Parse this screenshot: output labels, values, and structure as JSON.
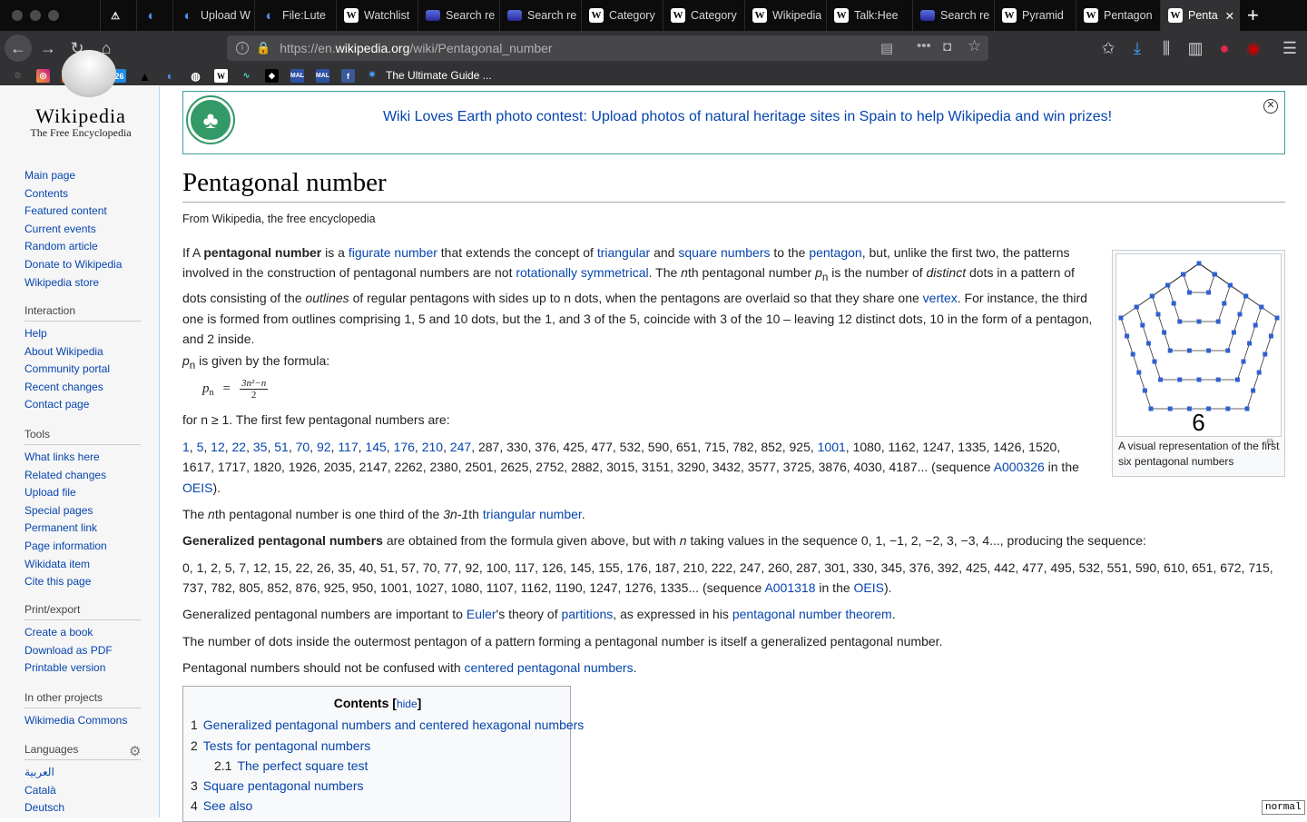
{
  "browser": {
    "tabs": [
      {
        "icon": "warning-icon",
        "label": ""
      },
      {
        "icon": "firefox-icon",
        "label": ""
      },
      {
        "icon": "firefox-icon",
        "label": "Upload W"
      },
      {
        "icon": "firefox-icon",
        "label": "File:Lute"
      },
      {
        "icon": "wikipedia-icon",
        "label": "Watchlist"
      },
      {
        "icon": "search-favicon",
        "label": "Search re"
      },
      {
        "icon": "search-favicon",
        "label": "Search re"
      },
      {
        "icon": "wikipedia-icon",
        "label": "Category"
      },
      {
        "icon": "wikipedia-icon",
        "label": "Category"
      },
      {
        "icon": "wikipedia-icon",
        "label": "Wikipedia"
      },
      {
        "icon": "wikipedia-icon",
        "label": "Talk:Hee"
      },
      {
        "icon": "search-favicon",
        "label": "Search re"
      },
      {
        "icon": "wikipedia-icon",
        "label": "Pyramid"
      },
      {
        "icon": "wikipedia-icon",
        "label": "Pentagon"
      },
      {
        "icon": "wikipedia-icon",
        "label": "Penta"
      }
    ],
    "url_prefix": "https://en.",
    "url_domain": "wikipedia.org",
    "url_path": "/wiki/Pentagonal_number",
    "bookmark_label": "The Ultimate Guide ...",
    "bookmark_icons": [
      "Y",
      "26",
      "MAL",
      "MAL",
      "f"
    ]
  },
  "sidebar": {
    "wordmark": "Wikipedia",
    "tagline": "The Free Encyclopedia",
    "nav": [
      "Main page",
      "Contents",
      "Featured content",
      "Current events",
      "Random article",
      "Donate to Wikipedia",
      "Wikipedia store"
    ],
    "interaction_heading": "Interaction",
    "interaction": [
      "Help",
      "About Wikipedia",
      "Community portal",
      "Recent changes",
      "Contact page"
    ],
    "tools_heading": "Tools",
    "tools": [
      "What links here",
      "Related changes",
      "Upload file",
      "Special pages",
      "Permanent link",
      "Page information",
      "Wikidata item",
      "Cite this page"
    ],
    "print_heading": "Print/export",
    "print": [
      "Create a book",
      "Download as PDF",
      "Printable version"
    ],
    "projects_heading": "In other projects",
    "projects": [
      "Wikimedia Commons"
    ],
    "languages_heading": "Languages",
    "languages": [
      "العربية",
      "Català",
      "Deutsch"
    ]
  },
  "banner": {
    "message": "Wiki Loves Earth photo contest: Upload photos of natural heritage sites in Spain to help Wikipedia and win prizes!"
  },
  "article": {
    "title": "Pentagonal number",
    "subtitle": "From Wikipedia, the free encyclopedia",
    "formula_intro": "is given by the formula:",
    "formula_lhs": "p",
    "formula_sub": "n",
    "formula_num": "3n²−n",
    "formula_den": "2",
    "formula_after": "for n ≥ 1. The first few pentagonal numbers are:",
    "sequence_links": [
      "1",
      "5",
      "12",
      "22",
      "35",
      "51",
      "70",
      "92",
      "117",
      "145",
      "176",
      "210",
      "247"
    ],
    "sequence_mid": "287, 330, 376, 425, 477, 532, 590, 651, 715, 782, 852, 925,",
    "sequence_link2": "1001",
    "sequence_tail": ", 1080, 1162, 1247, 1335, 1426, 1520, 1617, 1717, 1820, 1926, 2035, 2147, 2262, 2380, 2501, 2625, 2752, 2882, 3015, 3151, 3290, 3432, 3577, 3725, 3876, 4030, 4187... (sequence ",
    "oeis1": "A000326",
    "in_the": " in the ",
    "oeis_label": "OEIS",
    "gen_sequence": "0, 1, 2, 5, 7, 12, 15, 22, 26, 35, 40, 51, 57, 70, 77, 92, 100, 117, 126, 145, 155, 176, 187, 210, 222, 247, 260, 287, 301, 330, 345, 376, 392, 425, 442, 477, 495, 532, 551, 590, 610, 651, 672, 715, 737, 782, 805, 852, 876, 925, 950, 1001, 1027, 1080, 1107, 1162, 1190, 1247, 1276, 1335... (sequence ",
    "oeis2": "A001318",
    "last_para": "Pentagonal numbers should not be confused with ",
    "last_link": "centered pentagonal numbers",
    "figure_number": "6",
    "figure_caption": "A visual representation of the first six pentagonal numbers"
  },
  "toc": {
    "title": "Contents",
    "hide": "hide",
    "items": [
      {
        "num": "1",
        "label": "Generalized pentagonal numbers and centered hexagonal numbers"
      },
      {
        "num": "2",
        "label": "Tests for pentagonal numbers"
      },
      {
        "num": "2.1",
        "label": "The perfect square test"
      },
      {
        "num": "3",
        "label": "Square pentagonal numbers"
      },
      {
        "num": "4",
        "label": "See also"
      }
    ]
  },
  "status_badge": "normal"
}
